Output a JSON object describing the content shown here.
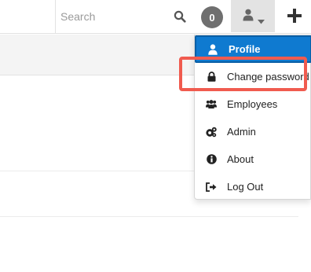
{
  "topbar": {
    "search": {
      "placeholder": "Search",
      "value": ""
    },
    "notification_count": "0"
  },
  "user_menu": {
    "items": [
      {
        "label": "Profile",
        "icon": "user-icon",
        "active": true
      },
      {
        "label": "Change password",
        "icon": "lock-icon",
        "highlighted": true
      },
      {
        "label": "Employees",
        "icon": "users-icon"
      },
      {
        "label": "Admin",
        "icon": "cogs-icon"
      },
      {
        "label": "About",
        "icon": "info-icon"
      },
      {
        "label": "Log Out",
        "icon": "logout-icon"
      }
    ]
  },
  "colors": {
    "active_item": "#0f7ad0",
    "highlight": "#f05b4f",
    "badge": "#6f6f6f"
  }
}
